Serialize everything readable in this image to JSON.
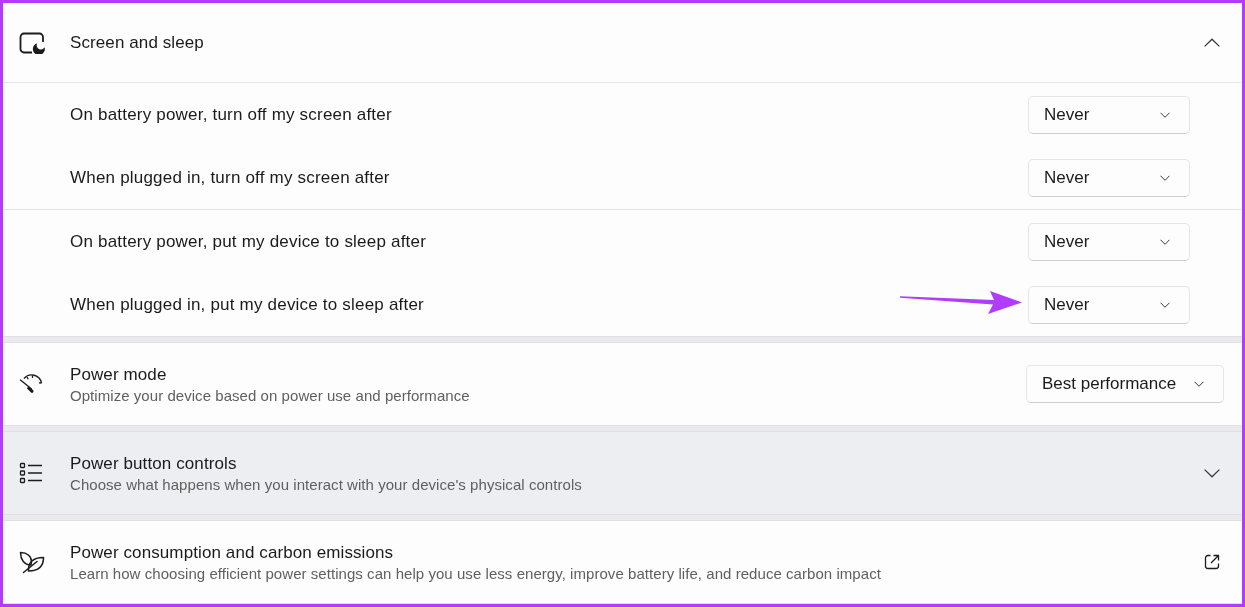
{
  "sections": [
    {
      "kind": "expander",
      "title": "Screen and sleep",
      "expanded": true,
      "hovered": false,
      "groups": [
        {
          "settings": [
            {
              "label": "On battery power, turn off my screen after",
              "value": "Never",
              "annotated": false
            },
            {
              "label": "When plugged in, turn off my screen after",
              "value": "Never",
              "annotated": false
            }
          ]
        },
        {
          "settings": [
            {
              "label": "On battery power, put my device to sleep after",
              "value": "Never",
              "annotated": false
            },
            {
              "label": "When plugged in, put my device to sleep after",
              "value": "Never",
              "annotated": true
            }
          ]
        }
      ]
    },
    {
      "kind": "dropdown",
      "title": "Power mode",
      "description": "Optimize your device based on power use and performance",
      "value": "Best performance",
      "hovered": false
    },
    {
      "kind": "expander",
      "title": "Power button controls",
      "description": "Choose what happens when you interact with your device's physical controls",
      "expanded": false,
      "hovered": true
    },
    {
      "kind": "link",
      "title": "Power consumption and carbon emissions",
      "description": "Learn how choosing efficient power settings can help you use less energy, improve battery life, and reduce carbon impact",
      "hovered": false
    }
  ]
}
